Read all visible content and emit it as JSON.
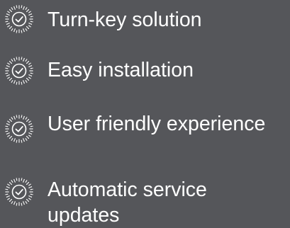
{
  "features": [
    {
      "label": "Turn-key solution",
      "icon": "check-badge-icon"
    },
    {
      "label": "Easy installation",
      "icon": "check-badge-icon"
    },
    {
      "label": "User friendly experience",
      "icon": "check-badge-icon"
    },
    {
      "label": "Automatic service updates",
      "icon": "check-badge-icon"
    }
  ],
  "colors": {
    "background": "#55565a",
    "text": "#ffffff"
  }
}
